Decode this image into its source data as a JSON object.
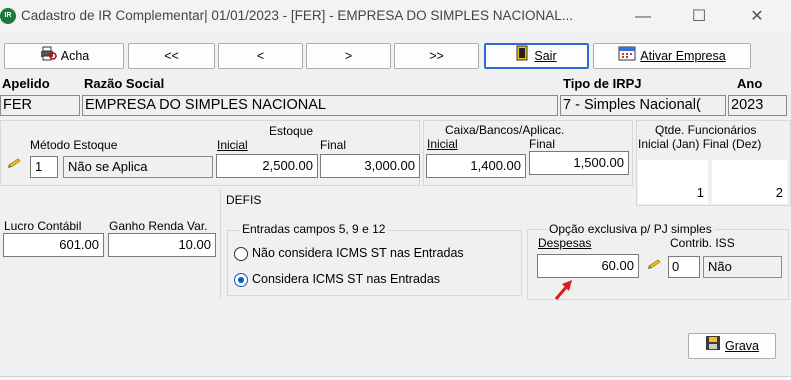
{
  "window": {
    "app_icon": "IR",
    "title": "Cadastro de IR Complementar|  01/01/2023 - [FER] - EMPRESA DO SIMPLES NACIONAL...",
    "minimize": "—",
    "maximize": "☐",
    "close": "✕"
  },
  "toolbar": {
    "acha": "Acha",
    "first": "<<",
    "prev": "<",
    "next": ">",
    "last": ">>",
    "sair": "Sair",
    "ativar": "Ativar Empresa"
  },
  "header": {
    "apelido_label": "Apelido",
    "razao_label": "Razão Social",
    "tipo_label": "Tipo de IRPJ",
    "ano_label": "Ano",
    "apelido": "FER",
    "razao": "EMPRESA DO SIMPLES NACIONAL",
    "tipo": "7 - Simples Nacional(",
    "ano": "2023"
  },
  "estoque": {
    "metodo_label": "Método Estoque",
    "metodo_code": "1",
    "metodo_desc": "Não se Aplica",
    "group_label": "Estoque",
    "inicial_label": "Inicial",
    "final_label": "Final",
    "inicial": "2,500.00",
    "final": "3,000.00"
  },
  "caixa": {
    "group_label": "Caixa/Bancos/Aplicac.",
    "inicial_label": "Inicial",
    "final_label": "Final",
    "inicial": "1,400.00",
    "final": "1,500.00"
  },
  "funcionarios": {
    "label": "Qtde. Funcionários",
    "sublabel": "Inicial (Jan) Final (Dez)",
    "inicial": "1",
    "final": "2"
  },
  "defis": {
    "label": "DEFIS",
    "lucro_label": "Lucro Contábil",
    "ganho_label": "Ganho Renda Var.",
    "lucro": "601.00",
    "ganho": "10.00",
    "entradas_label": "Entradas campos 5, 9 e 12",
    "opt1": "Não considera ICMS ST nas Entradas",
    "opt2": "Considera ICMS ST nas Entradas",
    "selected": 2
  },
  "pj_simples": {
    "label": "Opção exclusiva p/ PJ simples",
    "despesas_label": "Despesas",
    "contrib_label": "Contrib. ISS",
    "despesas": "60.00",
    "contrib_code": "0",
    "contrib_desc": "Não"
  },
  "actions": {
    "grava": "Grava"
  },
  "colors": {
    "panel": "#f0f0f0",
    "accent": "#0a5cc8",
    "arrow": "#e11919"
  }
}
